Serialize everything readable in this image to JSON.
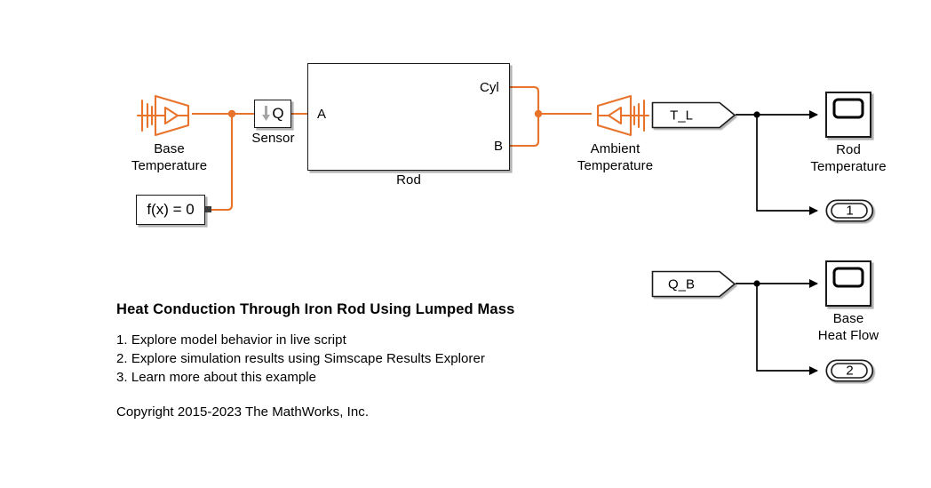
{
  "diagram": {
    "type": "simulink-model",
    "background_color": "#ffffff",
    "signal_color": "#000000",
    "physical_connection_color": "#E8742C"
  },
  "blocks": {
    "base_temperature": {
      "label": "Base\nTemperature",
      "icon": "thermal-source-icon",
      "color": "#E8742C"
    },
    "solver_configuration": {
      "label": "f(x) = 0",
      "icon": "solver-configuration-icon"
    },
    "sensor": {
      "label": "Sensor",
      "value": "Q",
      "icon": "heat-flow-rate-sensor-icon",
      "arrow_color": "#a6a6a6"
    },
    "rod": {
      "label": "Rod",
      "icon": "thermal-mass-cylinder-icon",
      "ports": {
        "a": "A",
        "cyl": "Cyl",
        "b": "B"
      }
    },
    "ambient_temperature": {
      "label": "Ambient\nTemperature",
      "icon": "thermal-source-icon-mirrored",
      "color": "#E8742C"
    },
    "tag_t_l": {
      "label": "T_L",
      "icon": "goto-tag-icon"
    },
    "tag_q_b": {
      "label": "Q_B",
      "icon": "goto-tag-icon"
    },
    "scope_rod_temperature": {
      "label": "Rod\nTemperature",
      "icon": "scope-icon"
    },
    "scope_base_heat_flow": {
      "label": "Base\nHeat Flow",
      "icon": "scope-icon"
    },
    "outport_1": {
      "label": "1",
      "icon": "outport-icon"
    },
    "outport_2": {
      "label": "2",
      "icon": "outport-icon"
    }
  },
  "annotation": {
    "title": "Heat Conduction Through Iron Rod Using Lumped Mass",
    "items": [
      "1. Explore model behavior in live script",
      "2. Explore simulation results using Simscape Results Explorer",
      "3. Learn more about this example"
    ],
    "copyright": "Copyright 2015-2023 The MathWorks, Inc."
  }
}
